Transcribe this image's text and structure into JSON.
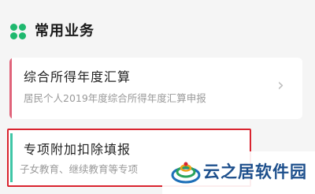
{
  "section": {
    "title": "常用业务",
    "icon": "grid-dots-icon",
    "accent": "#1fb86e"
  },
  "cards": [
    {
      "title": "综合所得年度汇算",
      "subtitle": "居民个人2019年度综合所得年度汇算申报",
      "accent": "#e0637a",
      "chevron": "›"
    },
    {
      "title": "专项附加扣除填报",
      "subtitle": "子女教育、继续教育等专项",
      "accent": "#3fc6a6",
      "chevron": "›",
      "highlight": "#d9242f"
    }
  ],
  "watermark": {
    "text": "云之居软件园",
    "icon": "yunzhiju-logo-icon"
  }
}
